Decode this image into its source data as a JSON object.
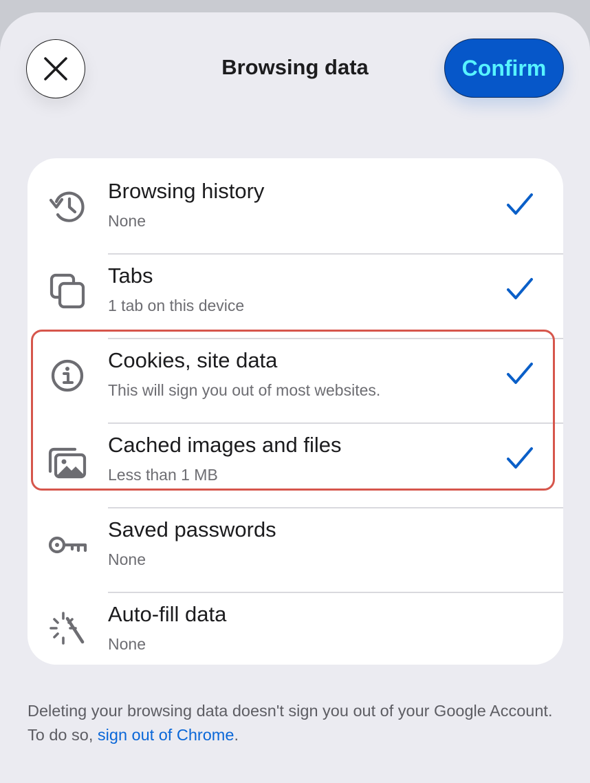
{
  "header": {
    "title": "Browsing data",
    "confirm_label": "Confirm"
  },
  "items": [
    {
      "label": "Browsing history",
      "sub": "None",
      "checked": true,
      "icon": "history-icon"
    },
    {
      "label": "Tabs",
      "sub": "1 tab on this device",
      "checked": true,
      "icon": "tabs-icon"
    },
    {
      "label": "Cookies, site data",
      "sub": "This will sign you out of most websites.",
      "checked": true,
      "icon": "info-icon"
    },
    {
      "label": "Cached images and files",
      "sub": "Less than 1 MB",
      "checked": true,
      "icon": "images-icon"
    },
    {
      "label": "Saved passwords",
      "sub": "None",
      "checked": false,
      "icon": "key-icon"
    },
    {
      "label": "Auto-fill data",
      "sub": "None",
      "checked": false,
      "icon": "magic-wand-icon"
    }
  ],
  "footer": {
    "text": "Deleting your browsing data doesn't sign you out of your Google Account. To do so, ",
    "link": "sign out of Chrome",
    "end": "."
  },
  "colors": {
    "accent": "#0657c9",
    "confirm_text": "#57f3ff",
    "check": "#0a5fc8",
    "highlight": "#d6564c",
    "link": "#0a67d8"
  }
}
